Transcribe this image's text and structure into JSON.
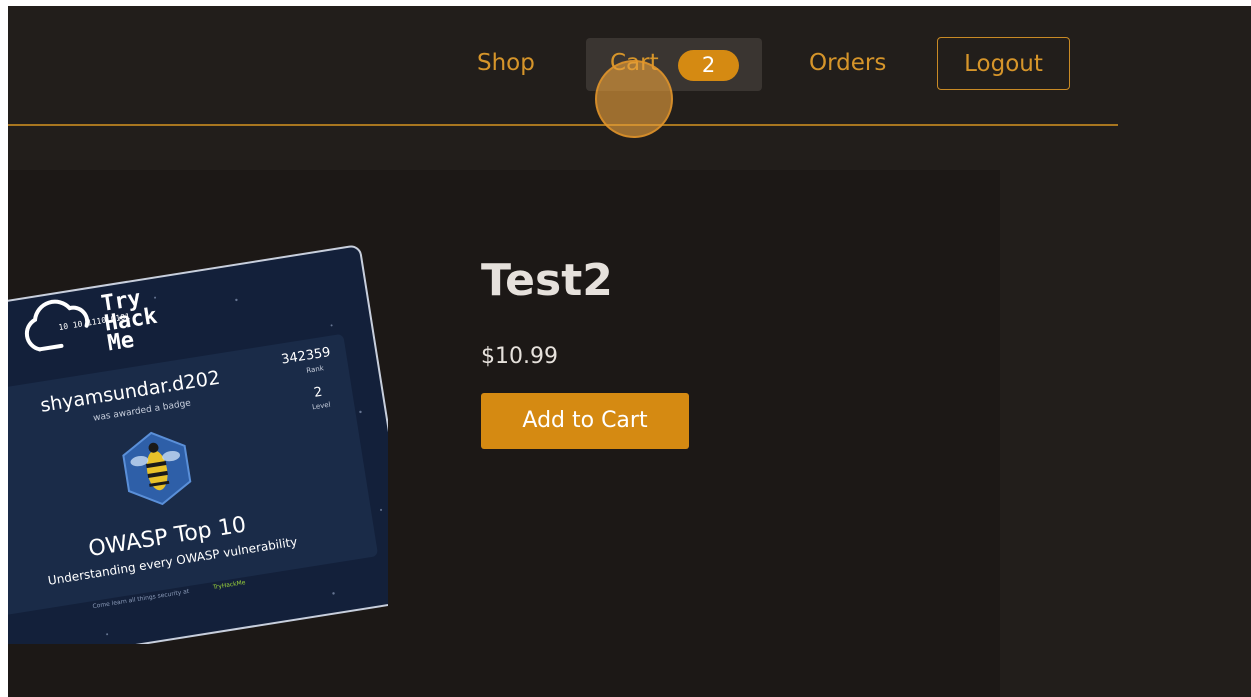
{
  "nav": {
    "shop_label": "Shop",
    "cart_label": "Cart",
    "cart_count": "2",
    "orders_label": "Orders",
    "logout_label": "Logout"
  },
  "product": {
    "title": "Test2",
    "price": "$10.99",
    "add_to_cart_label": "Add to Cart",
    "image": {
      "brand_line1": "Try",
      "brand_line2": "Hack",
      "brand_line3": "Me",
      "binary_text": "10 10 1110 0101",
      "username": "shyamsundar.d202",
      "awarded_text": "was awarded a badge",
      "rank_value": "342359",
      "rank_label": "Rank",
      "level_value": "2",
      "level_label": "Level",
      "badge_title": "OWASP Top 10",
      "badge_subtitle": "Understanding every OWASP vulnerability",
      "footer_text": "Come learn all things security at",
      "footer_brand": "TryHackMe"
    }
  },
  "colors": {
    "background": "#221e1b",
    "panel": "#1c1816",
    "accent": "#d58a12",
    "nav_text": "#d6952a",
    "text_light": "#e6e1dc"
  }
}
